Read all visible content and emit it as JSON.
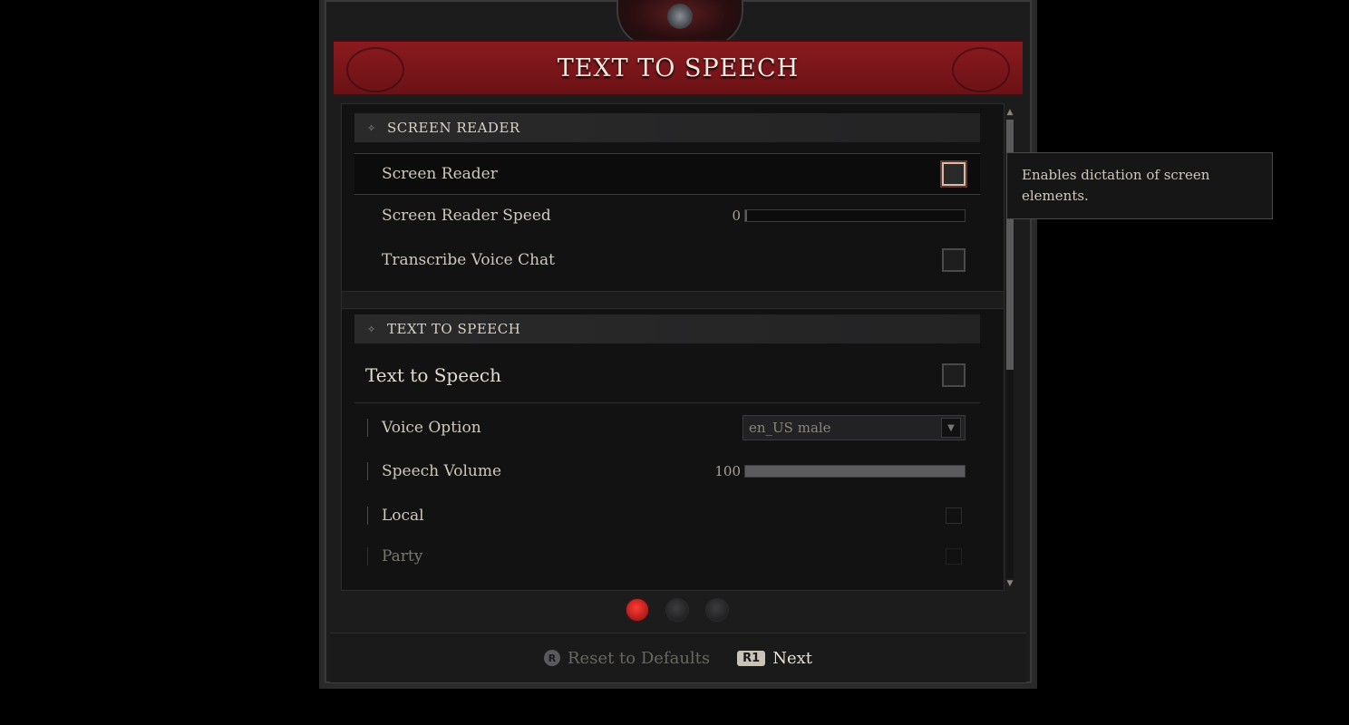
{
  "window": {
    "title": "TEXT TO SPEECH"
  },
  "screen_reader_section": {
    "header": "SCREEN READER",
    "screen_reader": {
      "label": "Screen Reader",
      "checked": false,
      "focused": true
    },
    "screen_reader_speed": {
      "label": "Screen Reader Speed",
      "value": "0",
      "level": 0
    },
    "transcribe_voice_chat": {
      "label": "Transcribe Voice Chat",
      "checked": false
    }
  },
  "text_to_speech_section": {
    "header": "TEXT TO SPEECH",
    "text_to_speech": {
      "label": "Text to Speech",
      "checked": false
    },
    "voice_option": {
      "label": "Voice Option",
      "selected": "en_US male"
    },
    "speech_volume": {
      "label": "Speech Volume",
      "value": "100",
      "level": 1.0
    },
    "local": {
      "label": "Local",
      "checked": false
    },
    "party": {
      "label": "Party",
      "checked": false
    }
  },
  "tooltip": {
    "text": "Enables dictation of screen elements."
  },
  "pager": {
    "pages": 3,
    "active_page": 1
  },
  "footer": {
    "reset": {
      "glyph": "R",
      "label": "Reset to Defaults"
    },
    "next": {
      "glyph": "R1",
      "label": "Next"
    }
  },
  "colors": {
    "accent": "#8a1a1f",
    "background": "#000000",
    "panel": "#121213",
    "active_dot": "#ff3a34"
  }
}
